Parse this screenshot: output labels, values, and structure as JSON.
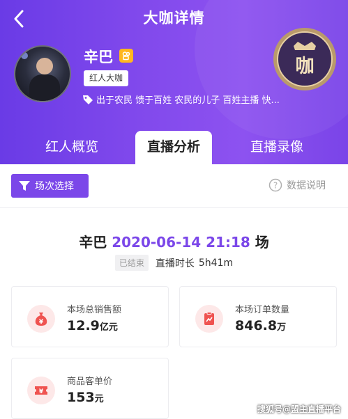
{
  "header": {
    "title": "大咖详情",
    "name": "辛巴",
    "role_tag": "红人大咖",
    "tags_text": "出于农民  馈于百姓  农民的儿子  百姓主播  快...",
    "seal_char": "咖"
  },
  "tabs": [
    {
      "label": "红人概览",
      "active": false
    },
    {
      "label": "直播分析",
      "active": true
    },
    {
      "label": "直播录像",
      "active": false
    }
  ],
  "toolbar": {
    "filter_label": "场次选择",
    "help_label": "数据说明"
  },
  "session": {
    "name": "辛巴",
    "datetime": "2020-06-14 21:18",
    "suffix": "场",
    "status": "已结束",
    "duration_label": "直播时长",
    "duration": "5h41m"
  },
  "metrics": [
    {
      "label": "本场总销售额",
      "value": "12.9",
      "unit": "亿元",
      "icon": "money-bag-icon"
    },
    {
      "label": "本场订单数量",
      "value": "846.8",
      "unit": "万",
      "icon": "clipboard-chart-icon"
    },
    {
      "label": "商品客单价",
      "value": "153",
      "unit": "元",
      "icon": "ticket-yen-icon"
    }
  ],
  "watermark": "搜狐号@盟主直播平台",
  "colors": {
    "accent": "#7b47e9",
    "header_gradient_start": "#6a3be6",
    "header_gradient_end": "#8d52f0",
    "metric_icon_bg": "#fde8e8",
    "metric_icon_fg": "#ef5350"
  }
}
